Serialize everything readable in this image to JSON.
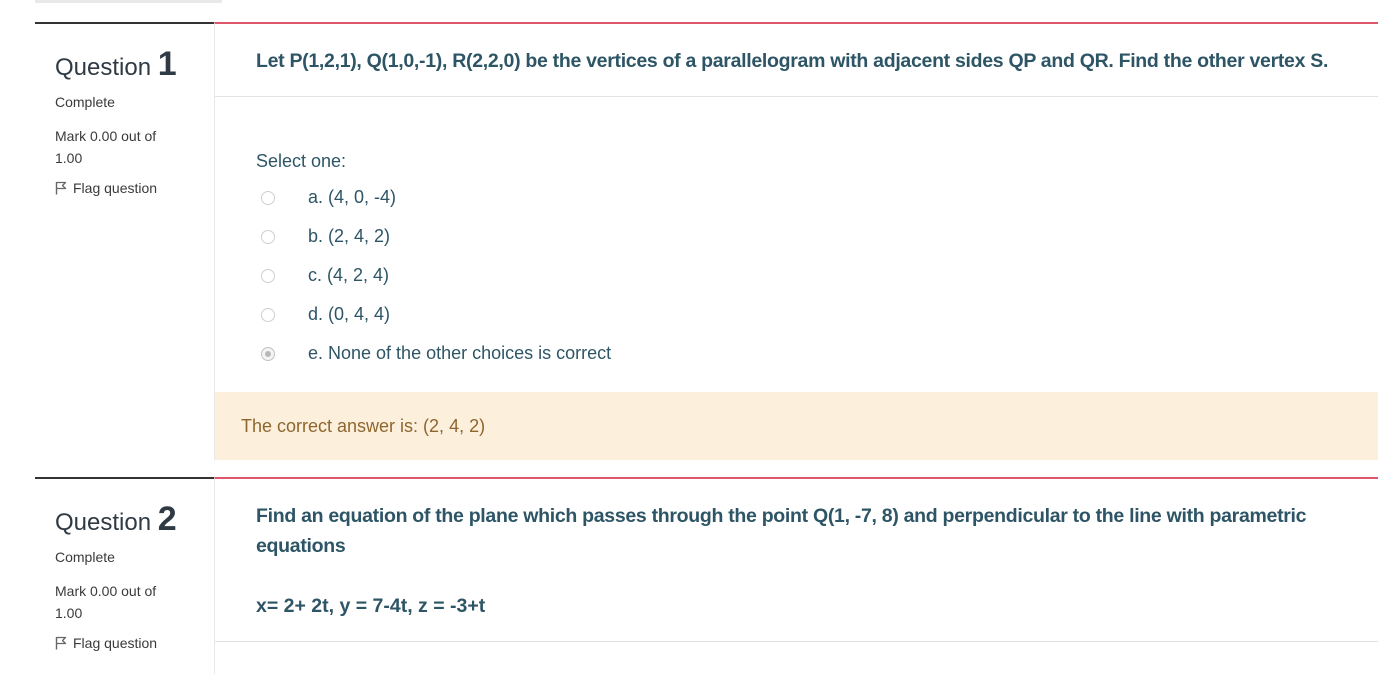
{
  "questions": [
    {
      "label": "Question",
      "number": "1",
      "state": "Complete",
      "grade": "Mark 0.00 out of 1.00",
      "flag_label": "Flag question",
      "text": "Let P(1,2,1), Q(1,0,-1), R(2,2,0) be the vertices of a parallelogram with adjacent sides QP and QR. Find the other vertex S.",
      "prompt": "Select one:",
      "options": [
        {
          "label": "a. (4, 0, -4)",
          "checked": false
        },
        {
          "label": "b. (2, 4, 2)",
          "checked": false
        },
        {
          "label": "c. (4, 2, 4)",
          "checked": false
        },
        {
          "label": "d. (0, 4, 4)",
          "checked": false
        },
        {
          "label": "e. None of the other choices is correct",
          "checked": true
        }
      ],
      "feedback": "The correct answer is: (2, 4, 2)"
    },
    {
      "label": "Question",
      "number": "2",
      "state": "Complete",
      "grade": "Mark 0.00 out of 1.00",
      "flag_label": "Flag question",
      "text": "Find an equation of the plane which passes through the point Q(1, -7, 8) and perpendicular to the line with parametric equations",
      "equation": "x= 2+ 2t, y = 7-4t, z = -3+t"
    }
  ],
  "colors": {
    "accent_border": "#e0566b",
    "question_text": "#2d5565",
    "feedback_bg": "#fcefdc",
    "feedback_text": "#8e662e"
  },
  "icons": {
    "flag": "flag-icon",
    "radio": "radio-button"
  }
}
